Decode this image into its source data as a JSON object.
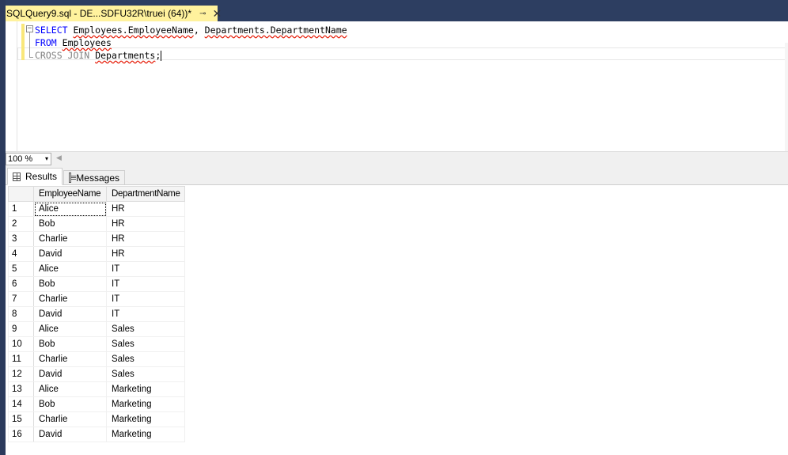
{
  "tab": {
    "title": "SQLQuery9.sql - DE...SDFU32R\\truei (64))*",
    "pin_glyph": "⊸",
    "close_glyph": "✕"
  },
  "editor": {
    "collapse_glyph": "−",
    "line1": {
      "kw": "SELECT",
      "a": "Employees.EmployeeName",
      "sep": ", ",
      "b": "Departments.DepartmentName"
    },
    "line2": {
      "kw": "FROM",
      "a": "Employees"
    },
    "line3": {
      "kw": "CROSS JOIN",
      "a": "Departments",
      "end": ";"
    }
  },
  "zoom": {
    "value": "100 %",
    "arrow": "▾",
    "scroll_left": "◀"
  },
  "results_tabs": [
    {
      "label": "Results",
      "icon": "grid-icon",
      "active": true
    },
    {
      "label": "Messages",
      "icon": "messages-icon",
      "active": false
    }
  ],
  "grid": {
    "columns": [
      "EmployeeName",
      "DepartmentName"
    ],
    "rows": [
      [
        "1",
        "Alice",
        "HR"
      ],
      [
        "2",
        "Bob",
        "HR"
      ],
      [
        "3",
        "Charlie",
        "HR"
      ],
      [
        "4",
        "David",
        "HR"
      ],
      [
        "5",
        "Alice",
        "IT"
      ],
      [
        "6",
        "Bob",
        "IT"
      ],
      [
        "7",
        "Charlie",
        "IT"
      ],
      [
        "8",
        "David",
        "IT"
      ],
      [
        "9",
        "Alice",
        "Sales"
      ],
      [
        "10",
        "Bob",
        "Sales"
      ],
      [
        "11",
        "Charlie",
        "Sales"
      ],
      [
        "12",
        "David",
        "Sales"
      ],
      [
        "13",
        "Alice",
        "Marketing"
      ],
      [
        "14",
        "Bob",
        "Marketing"
      ],
      [
        "15",
        "Charlie",
        "Marketing"
      ],
      [
        "16",
        "David",
        "Marketing"
      ]
    ]
  },
  "colors": {
    "frame": "#2d3e61",
    "active_tab": "#fff29d",
    "keyword": "#0000ff",
    "keyword_gray": "#808080",
    "squiggle": "#e51400"
  }
}
